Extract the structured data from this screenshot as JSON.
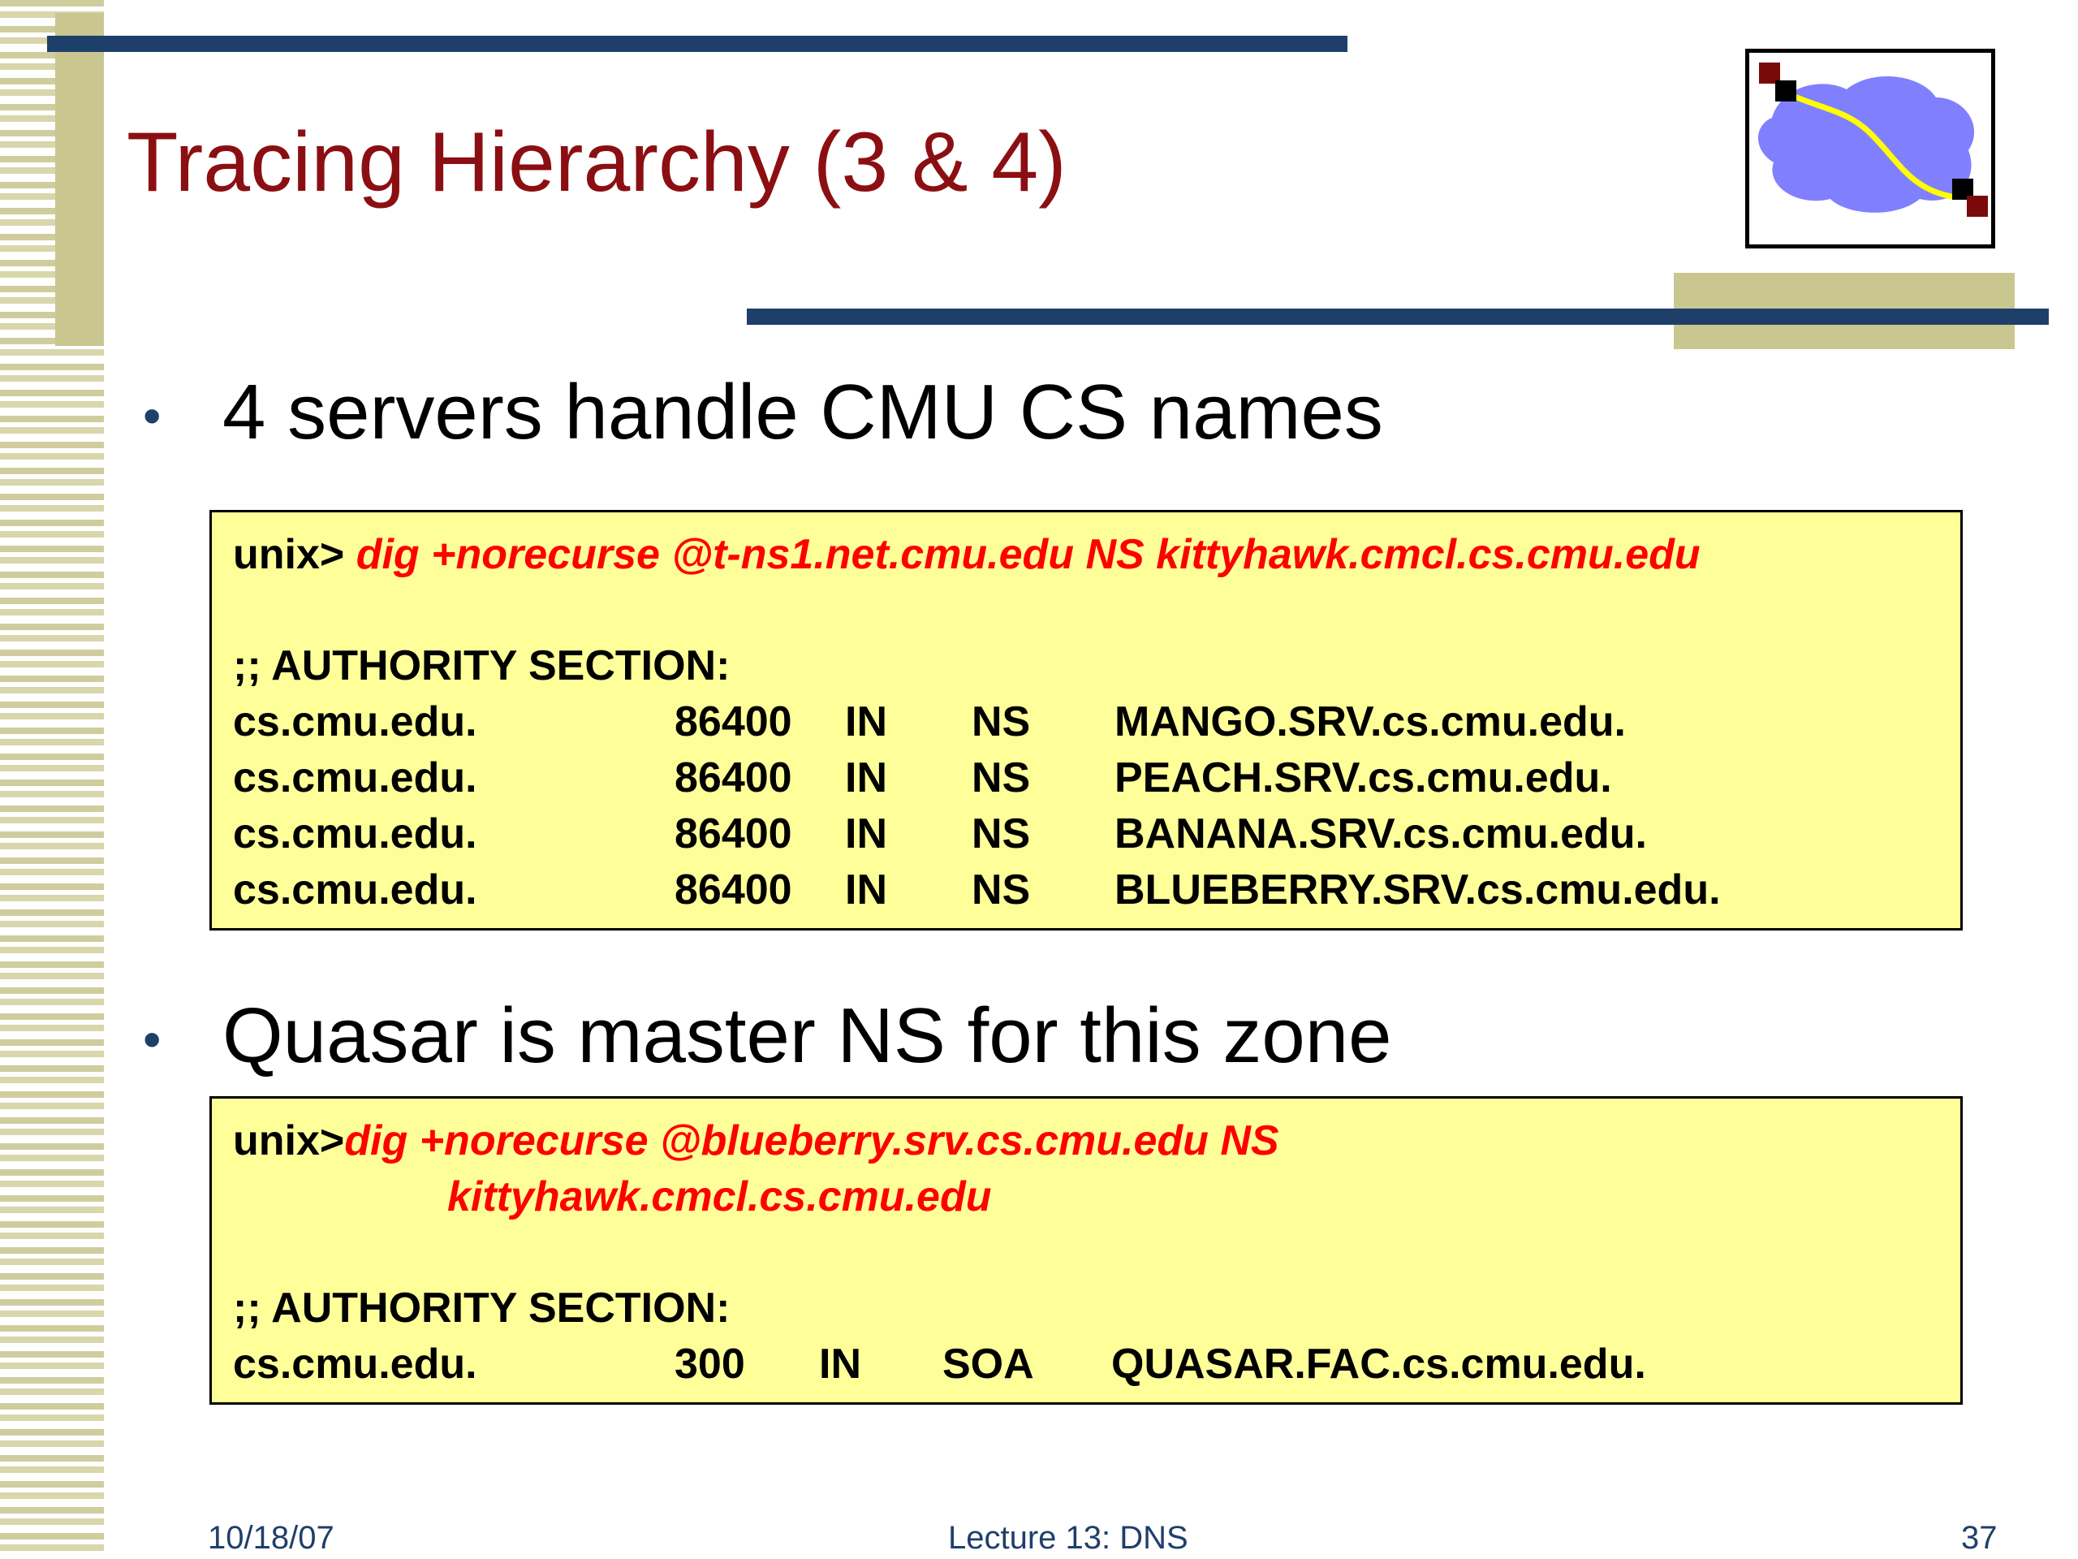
{
  "slide": {
    "title": "Tracing Hierarchy (3 & 4)",
    "bullet_symbol": "•",
    "bullets": [
      "4 servers handle CMU CS names",
      "Quasar is master NS for this zone"
    ]
  },
  "box1": {
    "prompt": "unix>",
    "command": "dig +norecurse @t-ns1.net.cmu.edu NS kittyhawk.cmcl.cs.cmu.edu",
    "section": ";; AUTHORITY SECTION:",
    "records": [
      {
        "name": "cs.cmu.edu.",
        "ttl": "86400",
        "class": "IN",
        "type": "NS",
        "value": "MANGO.SRV.cs.cmu.edu."
      },
      {
        "name": "cs.cmu.edu.",
        "ttl": "86400",
        "class": "IN",
        "type": "NS",
        "value": "PEACH.SRV.cs.cmu.edu."
      },
      {
        "name": "cs.cmu.edu.",
        "ttl": "86400",
        "class": "IN",
        "type": "NS",
        "value": "BANANA.SRV.cs.cmu.edu."
      },
      {
        "name": "cs.cmu.edu.",
        "ttl": "86400",
        "class": "IN",
        "type": "NS",
        "value": "BLUEBERRY.SRV.cs.cmu.edu."
      }
    ]
  },
  "box2": {
    "prompt": "unix>",
    "command_line1": "dig +norecurse @blueberry.srv.cs.cmu.edu NS",
    "command_line2": "kittyhawk.cmcl.cs.cmu.edu",
    "section": ";; AUTHORITY SECTION:",
    "records": [
      {
        "name": "cs.cmu.edu.",
        "ttl": "300",
        "class": "IN",
        "type": "SOA",
        "value": "QUASAR.FAC.cs.cmu.edu."
      }
    ]
  },
  "footer": {
    "date": "10/18/07",
    "lecture": "Lecture 13: DNS",
    "page": "37"
  },
  "colors": {
    "title": "#8b0f12",
    "accent_bar": "#1f3f6b",
    "stripe": "#c9c690",
    "code_background": "#ffff99",
    "command_text": "#ff0000",
    "logo_cloud": "#8080ff",
    "logo_path": "#ffff00"
  },
  "logo": {
    "icon": "network-path-cloud-icon"
  }
}
